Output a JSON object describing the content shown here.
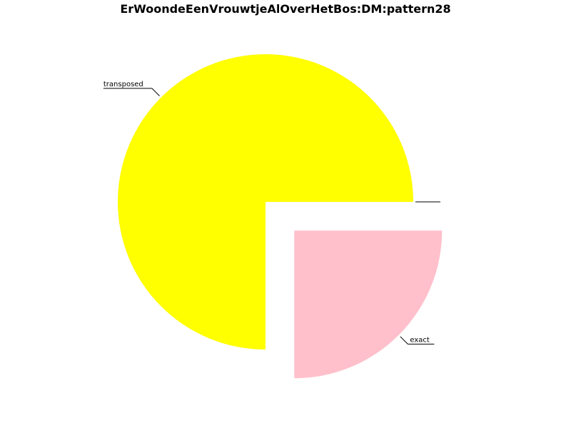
{
  "chart_data": {
    "type": "pie",
    "title": "ErWoondeEenVrouwtjeAlOverHetBos:DM:pattern28",
    "slices": [
      {
        "label": "transposed",
        "value": 75,
        "color": "#ffff00",
        "exploded": false
      },
      {
        "label": "exact",
        "value": 25,
        "color": "#ffc0cb",
        "exploded": true
      },
      {
        "label": "",
        "value": 0,
        "color": "#ffffff",
        "exploded": false
      },
      {
        "label": "",
        "value": 0,
        "color": "#ffffff",
        "exploded": false
      }
    ],
    "start_angle_deg": 0,
    "direction": "counterclockwise",
    "legend": "none"
  }
}
